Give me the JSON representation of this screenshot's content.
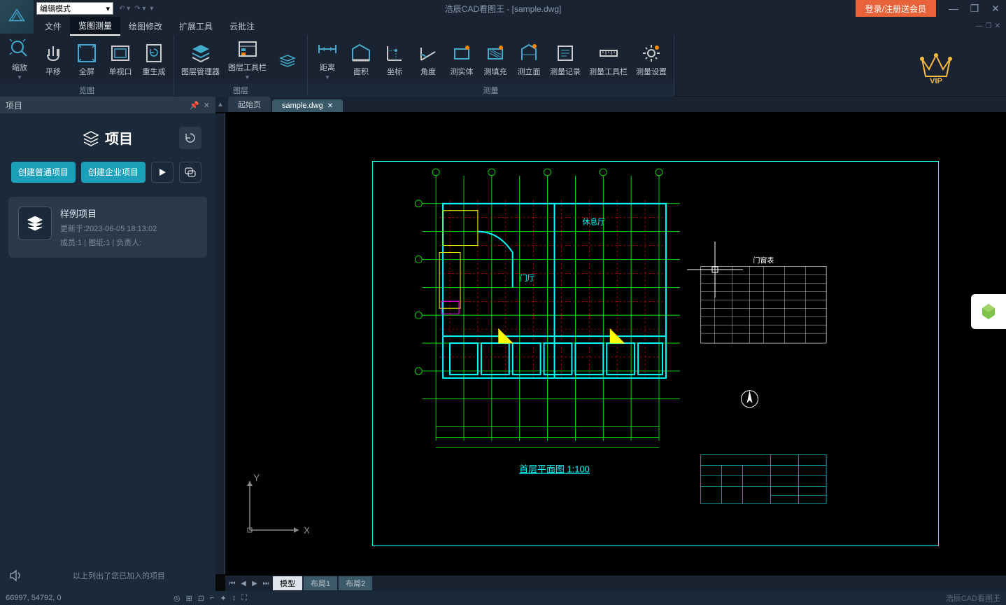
{
  "app": {
    "title": "浩辰CAD看图王 - [sample.dwg]",
    "mode": "编辑模式",
    "login_button": "登录/注册送会员"
  },
  "menu": {
    "items": [
      "文件",
      "览图测量",
      "绘图修改",
      "扩展工具",
      "云批注"
    ],
    "active_index": 1
  },
  "ribbon": {
    "groups": [
      {
        "label": "览图",
        "items": [
          {
            "label": "缩放",
            "icon": "zoom",
            "dropdown": true
          },
          {
            "label": "平移",
            "icon": "pan"
          },
          {
            "label": "全屏",
            "icon": "fullscreen"
          },
          {
            "label": "单视口",
            "icon": "viewport"
          },
          {
            "label": "重生成",
            "icon": "regen"
          }
        ]
      },
      {
        "label": "图层",
        "items": [
          {
            "label": "图层管理器",
            "icon": "layers"
          },
          {
            "label": "图层工具栏",
            "icon": "layertool",
            "dropdown": true
          },
          {
            "label": "",
            "icon": "layerstack"
          }
        ]
      },
      {
        "label": "测量",
        "items": [
          {
            "label": "距离",
            "icon": "distance",
            "dropdown": true
          },
          {
            "label": "面积",
            "icon": "area"
          },
          {
            "label": "坐标",
            "icon": "coord"
          },
          {
            "label": "角度",
            "icon": "angle"
          },
          {
            "label": "测实体",
            "icon": "entity"
          },
          {
            "label": "测填充",
            "icon": "fill"
          },
          {
            "label": "测立面",
            "icon": "elevation"
          },
          {
            "label": "测量记录",
            "icon": "record"
          },
          {
            "label": "测量工具栏",
            "icon": "measuretool"
          },
          {
            "label": "测量设置",
            "icon": "settings"
          }
        ]
      }
    ],
    "vip_label": "VIP"
  },
  "project_panel": {
    "header": "项目",
    "title": "项目",
    "create_normal": "创建普通项目",
    "create_enterprise": "创建企业项目",
    "sample": {
      "name": "样例项目",
      "updated": "更新于:2023-06-05 18:13:02",
      "meta": "成员:1 | 图纸:1 | 负责人:"
    },
    "footer": "以上列出了您已加入的项目"
  },
  "tabs": {
    "start": "起始页",
    "file": "sample.dwg"
  },
  "drawing": {
    "title": "首层平面图 1:100",
    "room1": "休息厅",
    "room2": "门厅",
    "table_title": "门窗表"
  },
  "layout_tabs": [
    "模型",
    "布局1",
    "布局2"
  ],
  "statusbar": {
    "coords": "66997, 54792, 0",
    "brand": "浩辰CAD看图王"
  }
}
